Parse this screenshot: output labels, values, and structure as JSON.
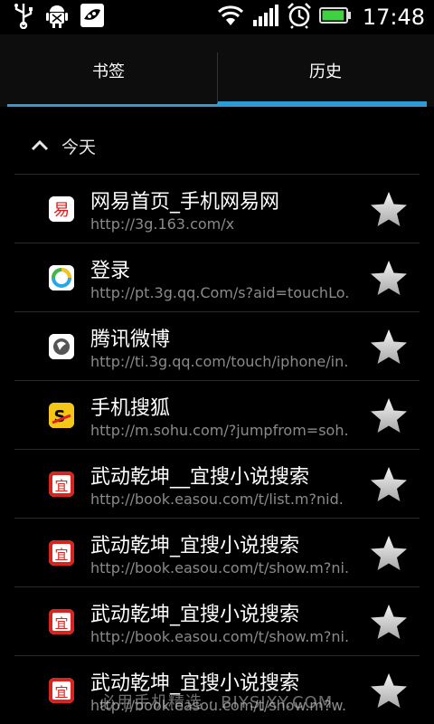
{
  "status_bar": {
    "time": "17:48",
    "left_icons": [
      "usb-icon",
      "android-debug-icon",
      "pea-pod-icon"
    ],
    "right_icons": [
      "wifi-icon",
      "signal-icon",
      "alarm-icon",
      "battery-icon"
    ],
    "battery_fraction": 0.95,
    "accent": "#3fd13f"
  },
  "tabs": [
    {
      "label": "书签",
      "selected": false
    },
    {
      "label": "历史",
      "selected": true
    }
  ],
  "accent_color": "#2c9bd6",
  "section": {
    "title": "今天",
    "icon": "chevron-up-icon"
  },
  "history": [
    {
      "title": "网易首页_手机网易网",
      "url": "http://3g.163.com/x",
      "icon": "netease-icon"
    },
    {
      "title": "登录",
      "url": "http://pt.3g.qq.Com/s?aid=touchLo.",
      "icon": "qq-login-icon"
    },
    {
      "title": "腾讯微博",
      "url": "http://ti.3g.qq.com/touch/iphone/in.",
      "icon": "tencent-weibo-icon"
    },
    {
      "title": "手机搜狐",
      "url": "http://m.sohu.com/?jumpfrom=soh.",
      "icon": "sohu-icon"
    },
    {
      "title": "武动乾坤__宜搜小说搜索",
      "url": "http://book.easou.com/t/list.m?nid.",
      "icon": "easou-icon"
    },
    {
      "title": "武动乾坤_宜搜小说搜索",
      "url": "http://book.easou.com/t/show.m?ni.",
      "icon": "easou-icon"
    },
    {
      "title": "武动乾坤_宜搜小说搜索",
      "url": "http://book.easou.com/t/show.m?ni.",
      "icon": "easou-icon"
    },
    {
      "title": "武动乾坤_宜搜小说搜索",
      "url": "http://book.easou.com/t/show.m?w.",
      "icon": "easou-icon"
    }
  ],
  "easou_glyph": "宜",
  "netease_glyph": "易",
  "watermark": "必用手机精选 · BIYSJXY.COM"
}
